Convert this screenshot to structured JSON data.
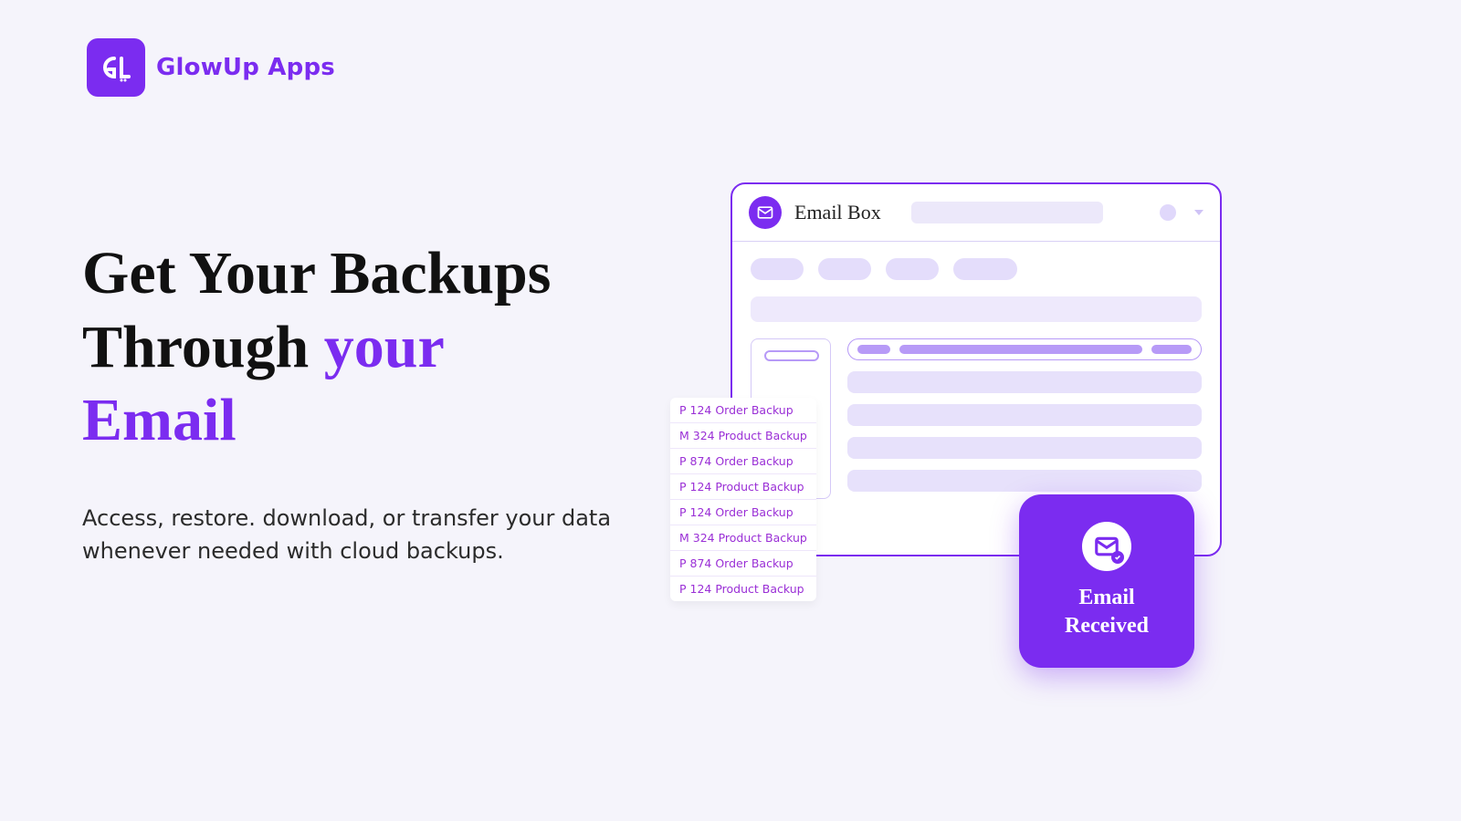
{
  "brand": {
    "name": "GlowUp Apps",
    "abbrev": "GU"
  },
  "colors": {
    "accent": "#7B2CF0",
    "bg": "#f5f4fb",
    "soft": "#e4ddfb"
  },
  "hero": {
    "line1": "Get Your Backups",
    "line2": "Through",
    "accent1": "your",
    "accent2": "Email",
    "subtitle": "Access, restore. download, or transfer your data whenever needed with cloud backups."
  },
  "inbox": {
    "title": "Email Box"
  },
  "backup_list": [
    "P 124 Order Backup",
    "M 324 Product Backup",
    "P 874 Order Backup",
    "P 124 Product Backup",
    "P 124 Order Backup",
    "M 324 Product Backup",
    "P 874 Order Backup",
    "P 124 Product Backup"
  ],
  "badge": {
    "line1": "Email",
    "line2": "Received"
  }
}
